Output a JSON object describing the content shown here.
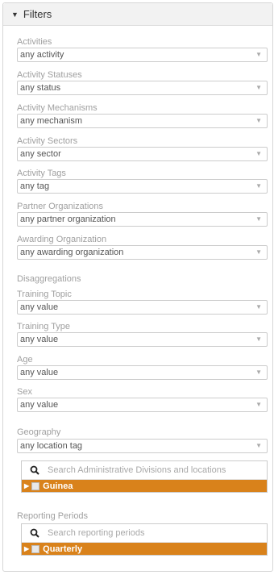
{
  "header": {
    "title": "Filters"
  },
  "filters": [
    {
      "label": "Activities",
      "value": "any activity"
    },
    {
      "label": "Activity Statuses",
      "value": "any status"
    },
    {
      "label": "Activity Mechanisms",
      "value": "any mechanism"
    },
    {
      "label": "Activity Sectors",
      "value": "any sector"
    },
    {
      "label": "Activity Tags",
      "value": "any tag"
    },
    {
      "label": "Partner Organizations",
      "value": "any partner organization"
    },
    {
      "label": "Awarding Organization",
      "value": "any awarding organization"
    }
  ],
  "disaggregations": {
    "title": "Disaggregations",
    "items": [
      {
        "label": "Training Topic",
        "value": "any value"
      },
      {
        "label": "Training Type",
        "value": "any value"
      },
      {
        "label": "Age",
        "value": "any value"
      },
      {
        "label": "Sex",
        "value": "any value"
      }
    ]
  },
  "geography": {
    "title": "Geography",
    "value": "any location tag",
    "search_placeholder": "Search Administrative Divisions and locations",
    "tree_item": "Guinea"
  },
  "reporting_periods": {
    "title": "Reporting Periods",
    "search_placeholder": "Search reporting periods",
    "tree_item": "Quarterly"
  },
  "colors": {
    "accent": "#d9821b",
    "border": "#cccccc",
    "label": "#a0a0a0"
  }
}
